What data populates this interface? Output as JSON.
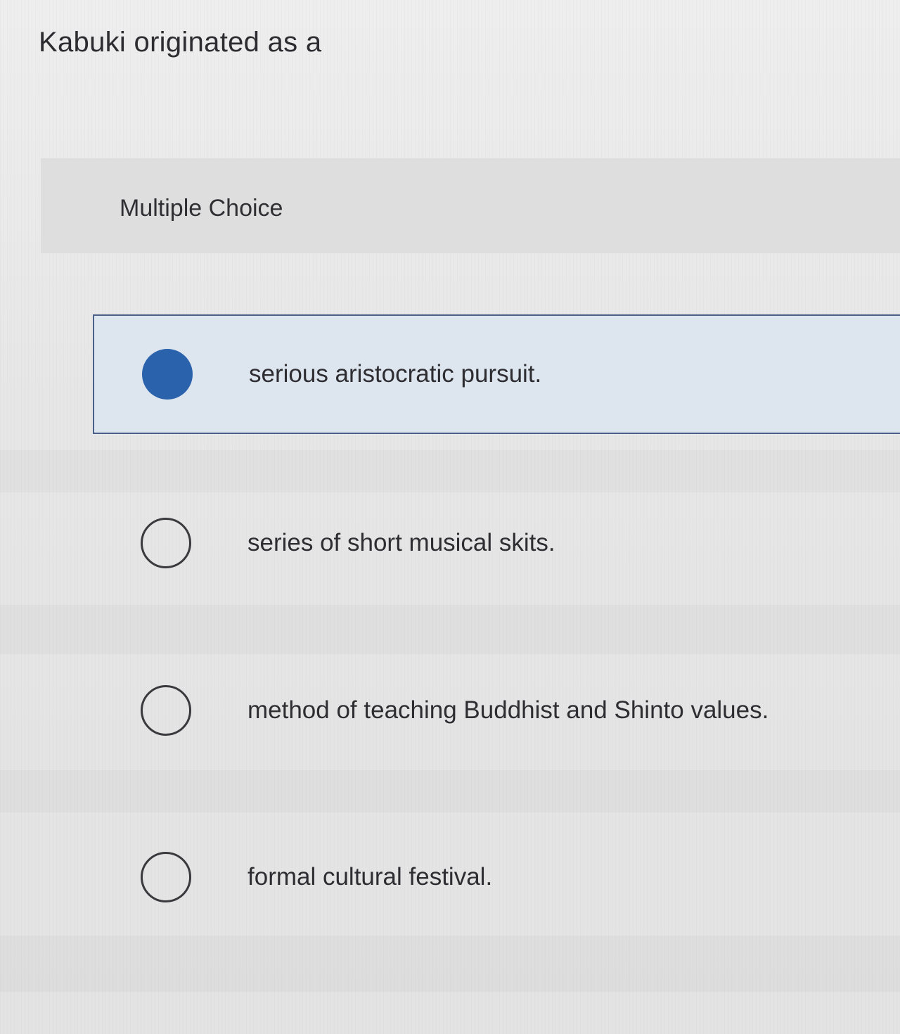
{
  "question": {
    "text": "Kabuki originated as a"
  },
  "question_type": {
    "label": "Multiple Choice"
  },
  "options": [
    {
      "label": "serious aristocratic pursuit.",
      "selected": true
    },
    {
      "label": "series of short musical skits.",
      "selected": false
    },
    {
      "label": "method of teaching Buddhist and Shinto values.",
      "selected": false
    },
    {
      "label": "formal cultural festival.",
      "selected": false
    }
  ],
  "colors": {
    "selected_radio": "#2a62ab",
    "selected_background": "#dde5ee",
    "selected_border": "#4a5f8a"
  }
}
